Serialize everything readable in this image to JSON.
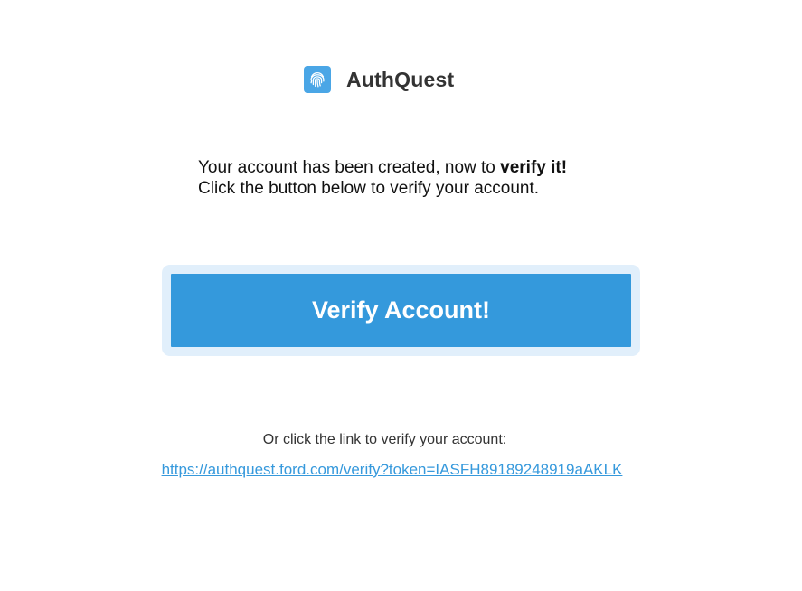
{
  "brand": {
    "name": "AuthQuest",
    "icon": "fingerprint-icon",
    "logo_color": "#4aa6e6"
  },
  "message": {
    "line1_prefix": "Your account has been created, now to ",
    "line1_emphasis": "verify it!",
    "line2": "Click the button below to verify your account."
  },
  "cta": {
    "label": "Verify Account!",
    "color": "#3499dc",
    "halo_color": "#e1effb"
  },
  "alternate": {
    "text": "Or click the link to verify your account:",
    "link": "https://authquest.ford.com/verify?token=IASFH89189248919aAKLK",
    "link_color": "#3699dc"
  }
}
